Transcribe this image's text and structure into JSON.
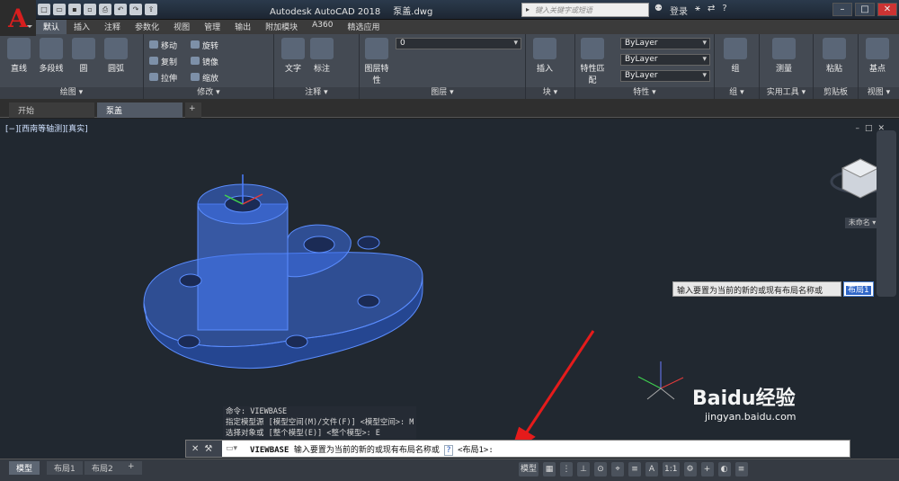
{
  "app_title": "Autodesk AutoCAD 2018",
  "file_name": "泵盖.dwg",
  "logo_letter": "A",
  "search_placeholder": "键入关键字或短语",
  "login_label": "登录",
  "quick_access": [
    "new",
    "open",
    "save",
    "saveas",
    "print",
    "undo",
    "redo",
    "share"
  ],
  "ribbon_tabs": [
    "默认",
    "插入",
    "注释",
    "参数化",
    "视图",
    "管理",
    "输出",
    "附加模块",
    "A360",
    "精选应用"
  ],
  "draw_panel": {
    "label": "绘图 ▾",
    "tools": [
      "直线",
      "多段线",
      "圆",
      "圆弧"
    ]
  },
  "modify_panel": {
    "label": "修改 ▾",
    "tools": [
      "移动",
      "旋转",
      "复制",
      "镜像",
      "拉伸",
      "缩放"
    ]
  },
  "annot_panel": {
    "label": "注释 ▾",
    "tools": [
      "文字",
      "标注"
    ]
  },
  "layers_panel": {
    "label": "图层 ▾",
    "tools": [
      "图层特性"
    ],
    "current_layer": "0"
  },
  "block_panel": {
    "label": "块 ▾",
    "tools": [
      "插入"
    ]
  },
  "props_panel": {
    "label": "特性 ▾",
    "tools": [
      "特性匹配"
    ],
    "color": "ByLayer",
    "linetype": "ByLayer",
    "lineweight": "ByLayer"
  },
  "groups_panel": {
    "label": "组 ▾",
    "tools": [
      "组"
    ]
  },
  "util_panel": {
    "label": "实用工具 ▾",
    "tools": [
      "测量"
    ]
  },
  "clip_panel": {
    "label": "剪贴板",
    "tools": [
      "粘贴"
    ]
  },
  "view_panel": {
    "label": "视图 ▾",
    "tools": [
      "基点"
    ]
  },
  "doc_tabs": [
    "开始",
    "泵盖"
  ],
  "viewport_label": "[−][西南等轴测][真实]",
  "viewcube_menu": "未命名 ▾",
  "command_history": [
    "命令: VIEWBASE",
    "指定模型源 [模型空间(M)/文件(F)] <模型空间>: M",
    "选择对象或 [整个模型(E)] <整个模型>: E"
  ],
  "dynamic_input": {
    "prompt": "输入要置为当前的新的或现有布局名称或",
    "value": "布局1"
  },
  "command_line": {
    "command": "VIEWBASE",
    "prompt": "输入要置为当前的新的或现有布局名称或",
    "option": "?",
    "default": "<布局1>:"
  },
  "layout_tabs": [
    "模型",
    "布局1",
    "布局2"
  ],
  "status": {
    "model_label": "模型",
    "scale": "1:1"
  },
  "watermark": {
    "brand": "Baidu经验",
    "url": "jingyan.baidu.com"
  }
}
